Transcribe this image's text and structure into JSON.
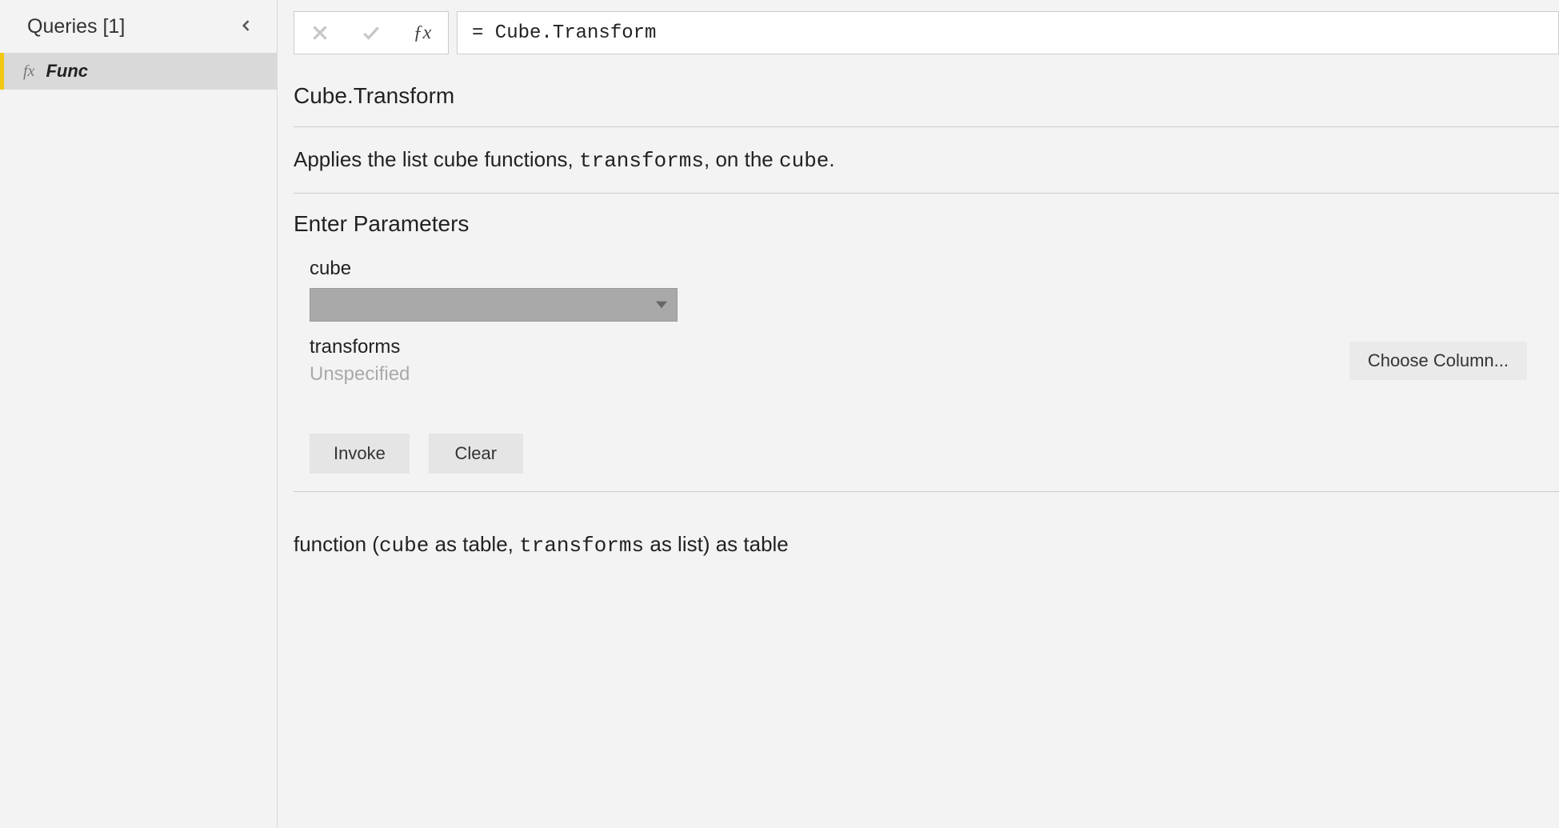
{
  "sidebar": {
    "title": "Queries [1]",
    "items": [
      {
        "icon": "fx",
        "label": "Func"
      }
    ]
  },
  "formula_bar": {
    "value": "= Cube.Transform"
  },
  "function": {
    "name": "Cube.Transform",
    "description_pre": "Applies the list cube functions, ",
    "description_param1": "transforms",
    "description_mid": ", on the ",
    "description_param2": "cube",
    "description_post": "."
  },
  "parameters": {
    "heading": "Enter Parameters",
    "cube_label": "cube",
    "transforms_label": "transforms",
    "unspecified_text": "Unspecified",
    "choose_column_label": "Choose Column..."
  },
  "buttons": {
    "invoke": "Invoke",
    "clear": "Clear"
  },
  "signature": {
    "s1": "function (",
    "p1": "cube",
    "s2": " as table, ",
    "p2": "transforms",
    "s3": " as list) as table"
  }
}
